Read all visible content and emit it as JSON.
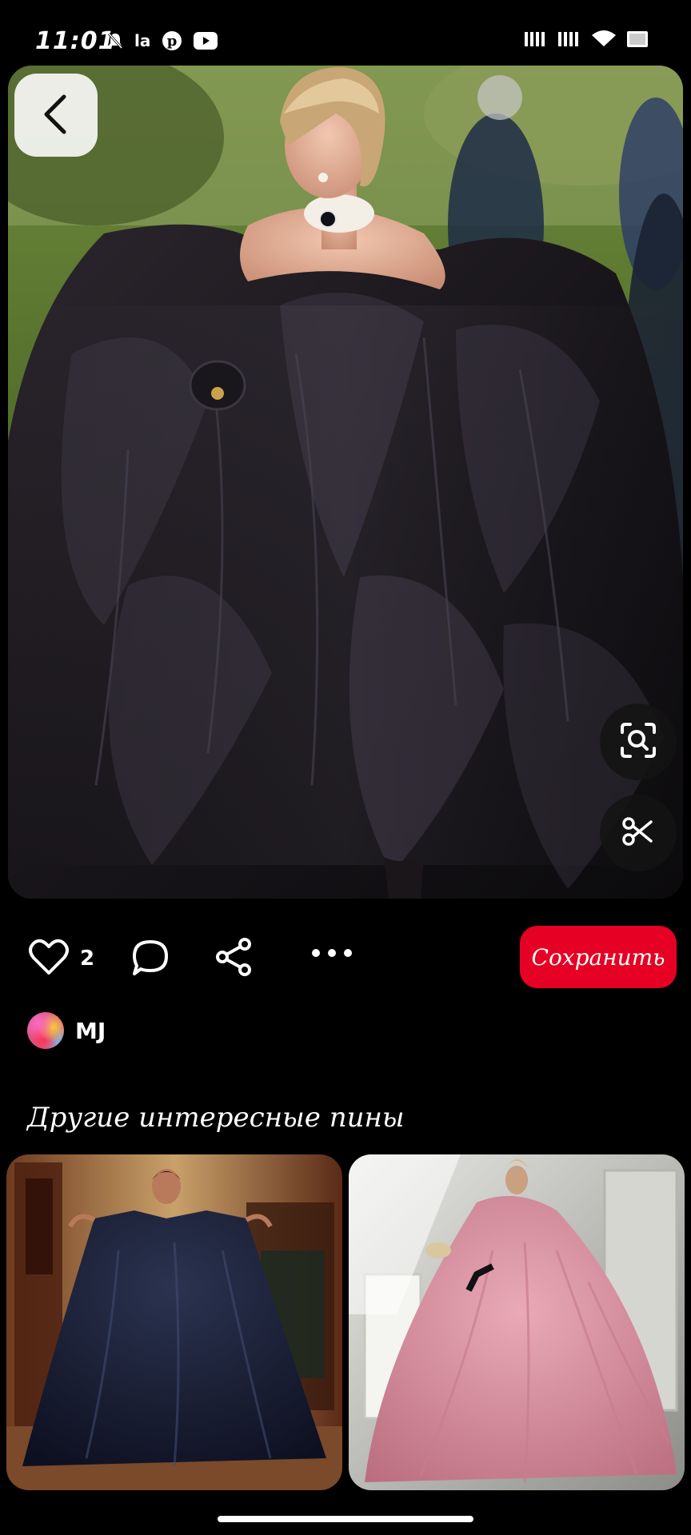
{
  "status_bar": {
    "time": "11:01",
    "app_label": "la",
    "icons_left": [
      "bell-muted-icon",
      "pinterest-icon",
      "youtube-icon"
    ],
    "icons_right": [
      "signal-icon",
      "signal-icon",
      "wifi-icon",
      "battery-icon"
    ]
  },
  "pin": {
    "image": "woman in voluminous black taffeta ball gown",
    "back_icon": "chevron-left-icon",
    "visual_search_icon": "lens-search-icon",
    "cutout_icon": "scissors-icon"
  },
  "actions": {
    "like_count": "2",
    "save_label": "Сохранить"
  },
  "author": {
    "name": "MJ"
  },
  "related": {
    "title": "Другие интересные пины",
    "pins": [
      {
        "image": "woman in dark navy ball gown in ornate room"
      },
      {
        "image": "woman in pink taffeta ball gown in white room"
      }
    ]
  },
  "colors": {
    "save_button": "#e60023",
    "background": "#000000"
  }
}
